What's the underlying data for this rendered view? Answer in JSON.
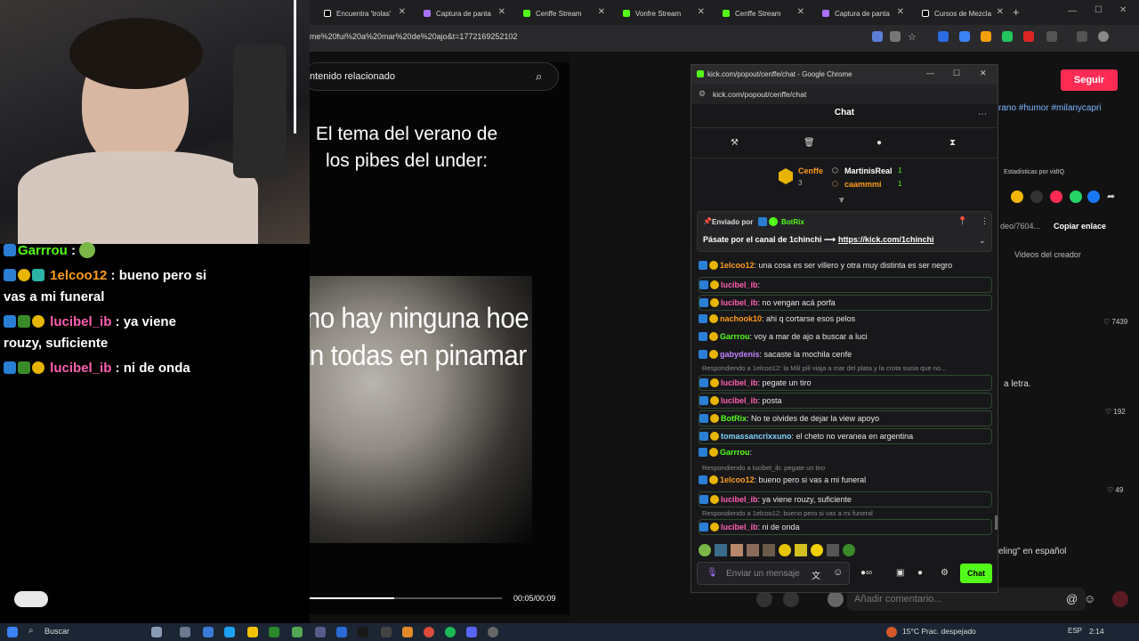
{
  "browser": {
    "tabs": [
      {
        "label": "Encuentra 'trolas'",
        "color": "#000000"
      },
      {
        "label": "Captura de panta",
        "color": "#a970ff"
      },
      {
        "label": "Cenffe Stream",
        "color": "#53fc18"
      },
      {
        "label": "Vonfre Stream",
        "color": "#53fc18"
      },
      {
        "label": "Cenffe Stream",
        "color": "#53fc18"
      },
      {
        "label": "Captura de panta",
        "color": "#a970ff"
      },
      {
        "label": "Cursos de Mezcla",
        "color": "#000000"
      }
    ],
    "url": "me%20fui%20a%20mar%20de%20ajo&t=1772169252102"
  },
  "left_chat": {
    "messages": [
      {
        "user": "Garrrou",
        "text": "",
        "user_color": "#53fc18"
      },
      {
        "user": "1elcoo12",
        "text": "bueno pero si vas a mi funeral",
        "user_color": "#ff9c1a"
      },
      {
        "user": "lucibel_ib",
        "text": "ya viene rouzy, suficiente",
        "user_color": "#ff5fb0"
      },
      {
        "user": "lucibel_ib",
        "text": "ni de onda",
        "user_color": "#ff5fb0"
      }
    ]
  },
  "video": {
    "search_text": "ntenido relacionado",
    "title": "El tema del verano de los pibes del under:",
    "subtitle": "y no hay ninguna hoe tan todas en pinamar",
    "timecode": "00:05/00:09",
    "progress": 0.56
  },
  "right_page": {
    "follow_button": "Seguir",
    "hashtags": "rano #humor #milanycapri",
    "vidiq": "Estadísticas por vidIQ",
    "link_partial": "deo/7604...",
    "copy_link": "Copiar enlace",
    "creator_videos": "Videos del creador",
    "likes": [
      "7439",
      "192",
      "49"
    ],
    "letra": "a letra.",
    "eling": "eling\" en español",
    "comment_placeholder": "Añadir comentario..."
  },
  "popout": {
    "window_title": "kick.com/popout/cenffe/chat - Google Chrome",
    "address": "kick.com/popout/cenffe/chat",
    "header": "Chat",
    "leaderboard": {
      "first": {
        "name": "Cenffe",
        "count": "3"
      },
      "second": {
        "name": "MartinisReal",
        "count": "1"
      },
      "third": {
        "name": "caammmi",
        "count": "1"
      }
    },
    "pinned": {
      "sent_by": "Enviado por",
      "sender": "BotRix",
      "text": "Pásate por el canal de 1chinchi ⟶",
      "link": "https://kick.com/1chinchi"
    },
    "messages": [
      {
        "reply": "",
        "user": "1elcoo12",
        "color": "#ff9c1a",
        "text": ": una cosa es ser villero y otra muy distinta es ser negro",
        "boxed": false
      },
      {
        "reply": "",
        "user": "lucibel_ib",
        "color": "#ff5fb0",
        "text": ":",
        "boxed": true
      },
      {
        "reply": "",
        "user": "lucibel_ib",
        "color": "#ff5fb0",
        "text": ": no vengan acá porfa",
        "boxed": true
      },
      {
        "reply": "",
        "user": "nachook10",
        "color": "#ff9c1a",
        "text": ": ahi q cortarse esos pelos",
        "boxed": false
      },
      {
        "reply": "",
        "user": "Garrrou",
        "color": "#53fc18",
        "text": ": voy a mar de ajo a buscar a luci",
        "boxed": false
      },
      {
        "reply": "",
        "user": "gabydenis",
        "color": "#c084fc",
        "text": ": sacaste la mochila cenfe",
        "boxed": false
      },
      {
        "reply": "Respondiendo a 1elcoo12: la Mili pili viaja a mar del plata y la crota sucia que no...",
        "user": "lucibel_ib",
        "color": "#ff5fb0",
        "text": ": pegate un tiro",
        "boxed": true
      },
      {
        "reply": "",
        "user": "lucibel_ib",
        "color": "#ff5fb0",
        "text": ": posta",
        "boxed": true
      },
      {
        "reply": "",
        "user": "BotRix",
        "color": "#53fc18",
        "text": ": No te olvides de dejar la view apoyo",
        "boxed": true
      },
      {
        "reply": "",
        "user": "tomassancrixxuno",
        "color": "#7dd3fc",
        "text": ": el cheto no veranea en argentina",
        "boxed": true
      },
      {
        "reply": "",
        "user": "Garrrou",
        "color": "#53fc18",
        "text": ":",
        "boxed": false
      },
      {
        "reply": "Respondiendo a lucibel_ib: pegate un tiro",
        "user": "1elcoo12",
        "color": "#ff9c1a",
        "text": ": bueno pero si vas a mi funeral",
        "boxed": false
      },
      {
        "reply": "",
        "user": "lucibel_ib",
        "color": "#ff5fb0",
        "text": ": ya viene rouzy, suficiente",
        "boxed": true
      },
      {
        "reply": "Respondiendo a 1elcoo12: bueno pero si vas a mi funeral",
        "user": "lucibel_ib",
        "color": "#ff5fb0",
        "text": ": ni de onda",
        "boxed": true
      }
    ],
    "input_placeholder": "Enviar un mensaje",
    "send_button": "Chat"
  },
  "taskbar": {
    "search": "Buscar",
    "weather": "15°C  Prac. despejado",
    "lang": "ESP",
    "time": "2:14"
  }
}
